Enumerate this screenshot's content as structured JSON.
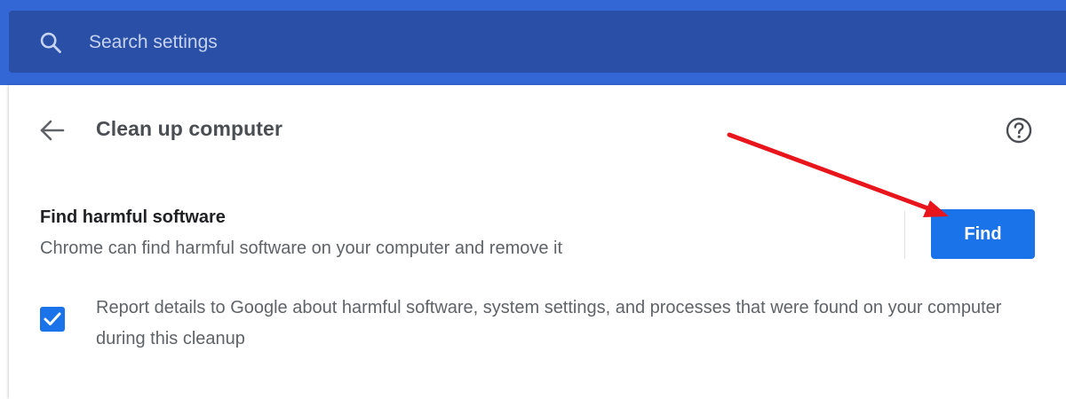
{
  "search": {
    "placeholder": "Search settings",
    "icon": "search-icon"
  },
  "page": {
    "title": "Clean up computer",
    "back_icon": "arrow-left-icon",
    "help_icon": "help-circle-icon"
  },
  "section": {
    "title": "Find harmful software",
    "description": "Chrome can find harmful software on your computer and remove it",
    "button_label": "Find"
  },
  "report": {
    "checked": true,
    "text": "Report details to Google about harmful software, system settings, and processes that were found on your computer during this cleanup"
  },
  "colors": {
    "header": "#3367d6",
    "search_box": "#2a4fa6",
    "accent": "#1a73e8",
    "annotation": "#e8161c"
  }
}
